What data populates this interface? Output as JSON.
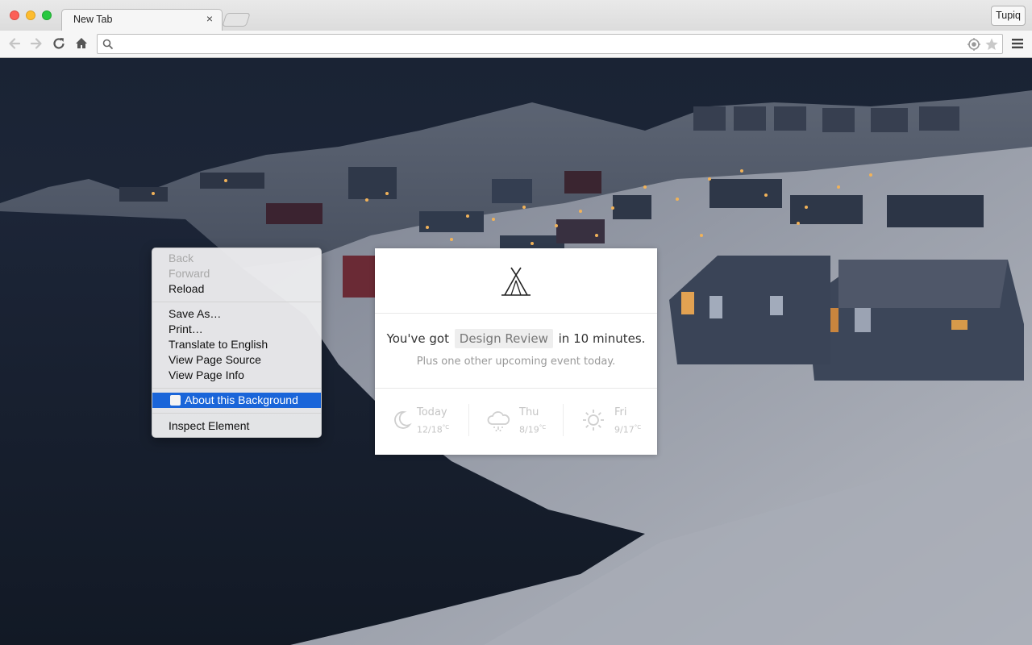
{
  "browser": {
    "tab_title": "New Tab",
    "tab_close": "×",
    "profile_name": "Tupiq",
    "omnibox_value": ""
  },
  "widget": {
    "headline_prefix": "You've got",
    "event_name": "Design Review",
    "headline_suffix": "in 10 minutes.",
    "subline": "Plus one other upcoming event today.",
    "forecast": [
      {
        "day": "Today",
        "low": "12",
        "high": "18",
        "unit": "°C",
        "icon": "moon-icon"
      },
      {
        "day": "Thu",
        "low": "8",
        "high": "19",
        "unit": "°C",
        "icon": "rain-cloud-icon"
      },
      {
        "day": "Fri",
        "low": "9",
        "high": "17",
        "unit": "°C",
        "icon": "sun-icon"
      }
    ]
  },
  "context_menu": {
    "back": "Back",
    "forward": "Forward",
    "reload": "Reload",
    "save_as": "Save As…",
    "print": "Print…",
    "translate": "Translate to English",
    "view_source": "View Page Source",
    "view_info": "View Page Info",
    "about_background": "About this Background",
    "inspect": "Inspect Element"
  },
  "colors": {
    "menu_highlight": "#1a65d9",
    "night_sky": "#1c2435",
    "snow": "#9ba0ab"
  }
}
